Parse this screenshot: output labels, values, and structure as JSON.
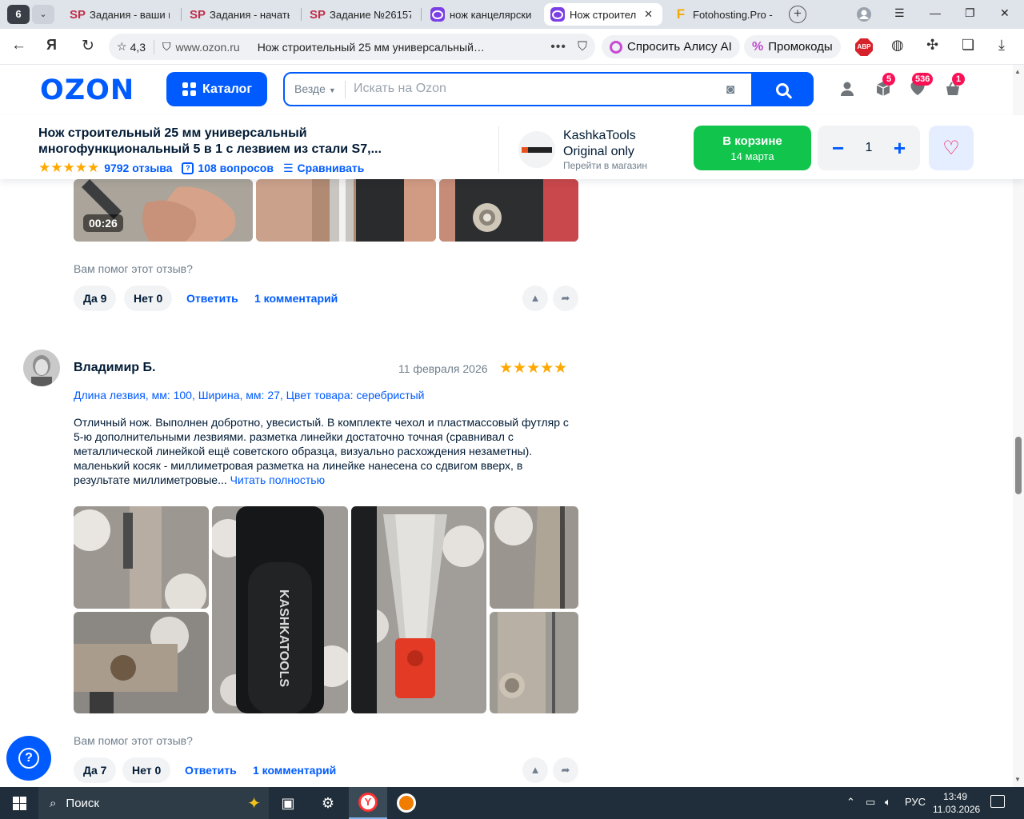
{
  "browser": {
    "tab_count": "6",
    "tabs": [
      {
        "label": "Задания - ваши и"
      },
      {
        "label": "Задания - начаты"
      },
      {
        "label": "Задание №26157"
      },
      {
        "label": "нож канцелярски"
      },
      {
        "label": "Нож строител"
      },
      {
        "label": "Fotohosting.Pro -"
      }
    ],
    "site_rating": "4,3",
    "domain": "www.ozon.ru",
    "page_title": "Нож строительный 25 мм универсальный…",
    "alice_label": "Спросить Алису AI",
    "promo_label": "Промокоды",
    "abp_label": "ABP"
  },
  "header": {
    "logo": "OZON",
    "catalog_label": "Каталог",
    "search_scope": "Везде",
    "search_placeholder": "Искать на Ozon",
    "badges": {
      "orders": "5",
      "favorites": "536",
      "cart": "1"
    }
  },
  "product": {
    "title": "Нож строительный 25 мм универсальный многофункциональный 5 в 1 с лезвием из стали S7,...",
    "reviews_count": "9792 отзыва",
    "questions_count": "108 вопросов",
    "compare_label": "Сравнивать",
    "store_name_line1": "KashkaTools",
    "store_name_line2": "Original only",
    "store_link": "Перейти в магазин",
    "cart_label": "В корзине",
    "cart_date": "14 марта",
    "quantity": "1"
  },
  "review1": {
    "video_time": "00:26",
    "helpful_prompt": "Вам помог этот отзыв?",
    "yes_label": "Да 9",
    "no_label": "Нет 0",
    "reply_label": "Ответить",
    "comments_label": "1 комментарий"
  },
  "review2": {
    "author": "Владимир Б.",
    "date": "11 февраля 2026",
    "rating": 5,
    "variant": "Длина лезвия, мм: 100, Ширина, мм: 27, Цвет товара: серебристый",
    "text": "Отличный нож. Выполнен добротно, увесистый. В комплекте чехол и пластмассовый футляр с 5-ю дополнительными лезвиями. разметка линейки достаточно точная (сравнивал с металлической линейкой ещё советского образца, визуально расхождения незаметны). маленький косяк - миллиметровая разметка на линейке нанесена со сдвигом вверх, в результате миллиметровые...",
    "read_more": "Читать полностью",
    "helpful_prompt": "Вам помог этот отзыв?",
    "yes_label": "Да 7",
    "no_label": "Нет 0",
    "reply_label": "Ответить",
    "comments_label": "1 комментарий"
  },
  "taskbar": {
    "search_label": "Поиск",
    "lang": "РУС",
    "time": "13:49",
    "date": "11.03.2026"
  },
  "colors": {
    "brand_blue": "#005bff",
    "cart_green": "#10c44c",
    "badge_pink": "#f91155",
    "star": "#ffa800"
  }
}
